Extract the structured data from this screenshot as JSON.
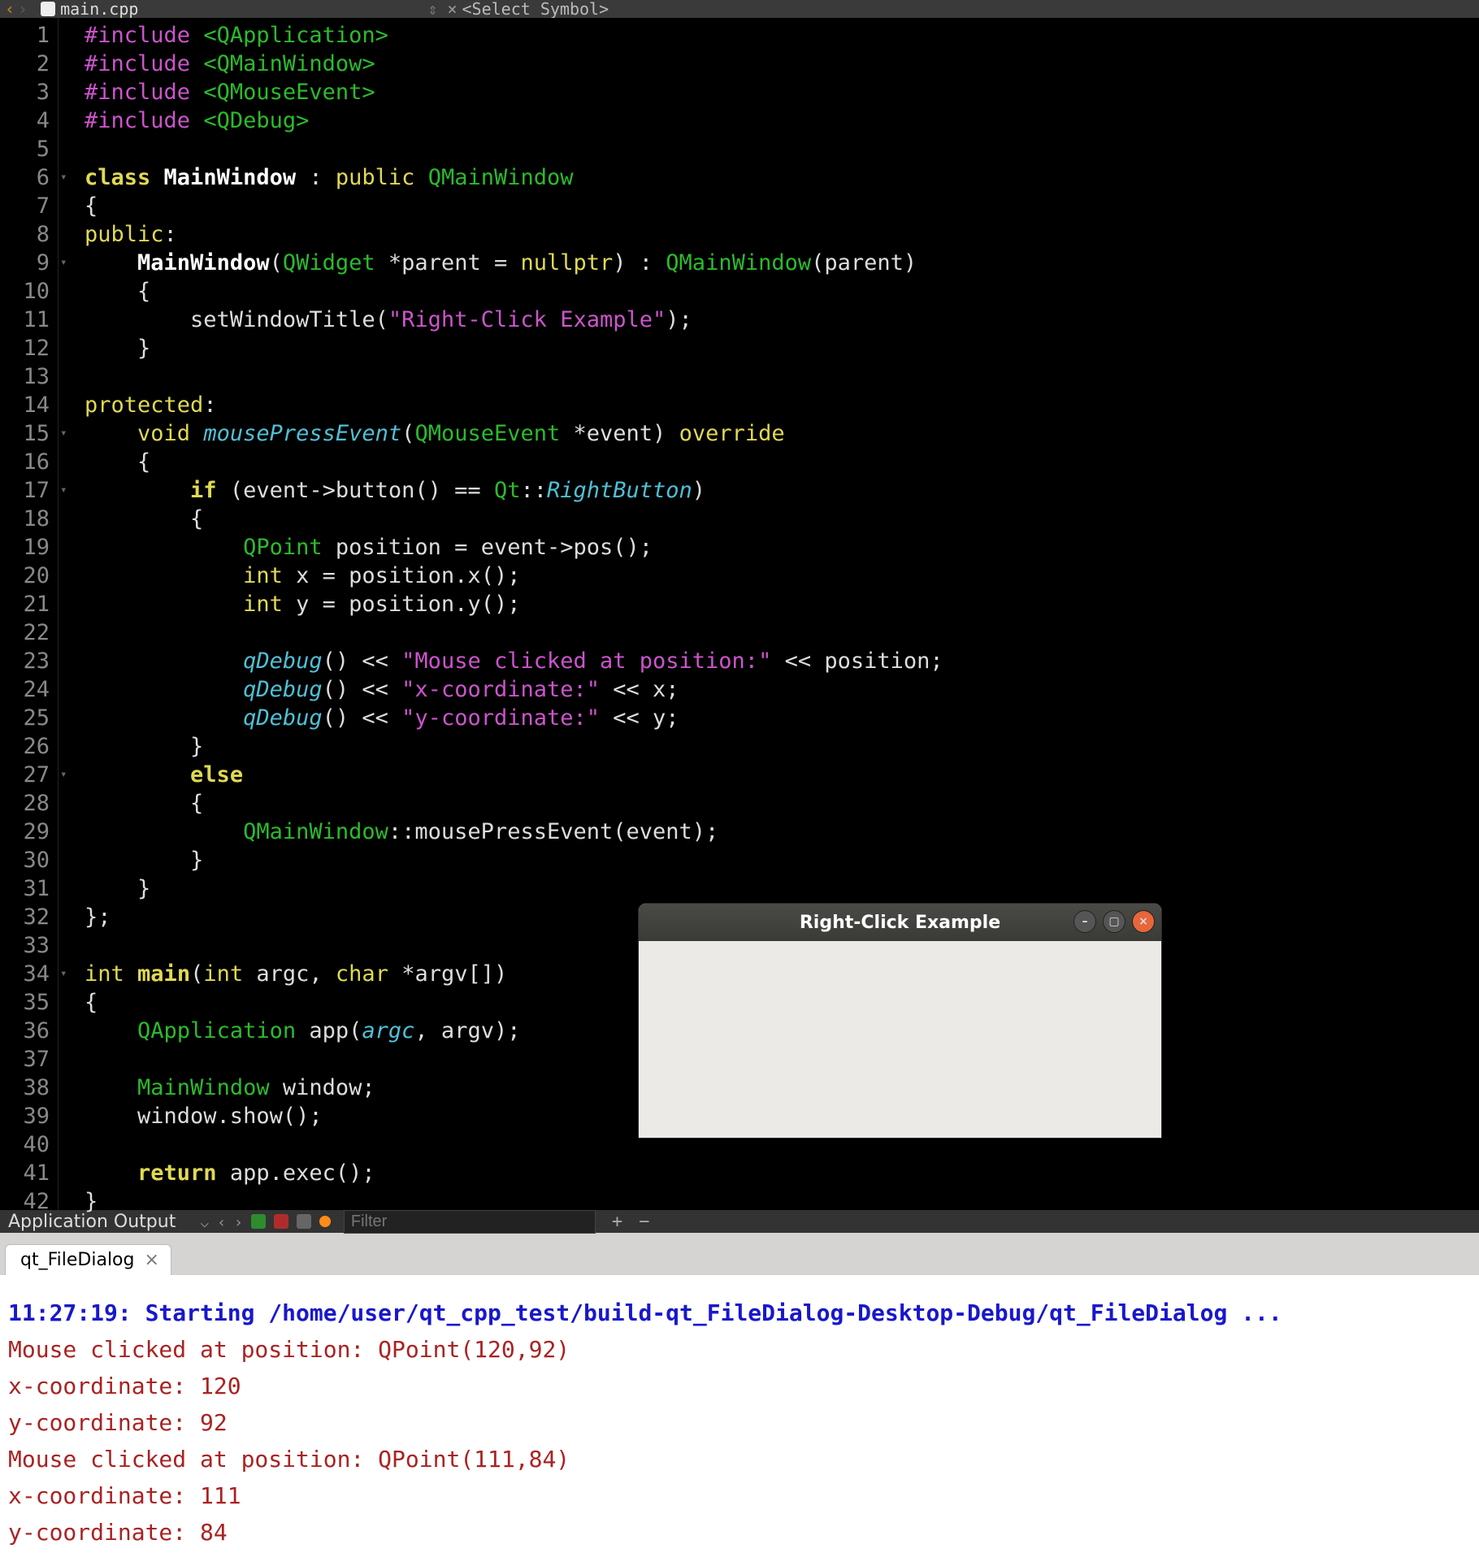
{
  "tabstrip": {
    "filename": "main.cpp",
    "symbol_selector": "<Select Symbol>"
  },
  "editor": {
    "line_count": 42,
    "fold_lines": [
      6,
      9,
      15,
      17,
      27,
      34
    ],
    "code_lines": [
      [
        {
          "c": "kw-inc",
          "t": "#include"
        },
        {
          "c": "op",
          "t": " "
        },
        {
          "c": "hdr",
          "t": "<QApplication>"
        }
      ],
      [
        {
          "c": "kw-inc",
          "t": "#include"
        },
        {
          "c": "op",
          "t": " "
        },
        {
          "c": "hdr",
          "t": "<QMainWindow>"
        }
      ],
      [
        {
          "c": "kw-inc",
          "t": "#include"
        },
        {
          "c": "op",
          "t": " "
        },
        {
          "c": "hdr",
          "t": "<QMouseEvent>"
        }
      ],
      [
        {
          "c": "kw-inc",
          "t": "#include"
        },
        {
          "c": "op",
          "t": " "
        },
        {
          "c": "hdr",
          "t": "<QDebug>"
        }
      ],
      [],
      [
        {
          "c": "kw-yel",
          "t": "class"
        },
        {
          "c": "op",
          "t": " "
        },
        {
          "c": "boldw",
          "t": "MainWindow"
        },
        {
          "c": "op",
          "t": " : "
        },
        {
          "c": "kw-yel2",
          "t": "public"
        },
        {
          "c": "op",
          "t": " "
        },
        {
          "c": "type",
          "t": "QMainWindow"
        }
      ],
      [
        {
          "c": "op",
          "t": "{"
        }
      ],
      [
        {
          "c": "kw-yel2",
          "t": "public"
        },
        {
          "c": "op",
          "t": ":"
        }
      ],
      [
        {
          "c": "op",
          "t": "    "
        },
        {
          "c": "boldw",
          "t": "MainWindow"
        },
        {
          "c": "op",
          "t": "("
        },
        {
          "c": "type",
          "t": "QWidget"
        },
        {
          "c": "op",
          "t": " *parent = "
        },
        {
          "c": "kw-yel2",
          "t": "nullptr"
        },
        {
          "c": "op",
          "t": ") : "
        },
        {
          "c": "type",
          "t": "QMainWindow"
        },
        {
          "c": "op",
          "t": "(parent)"
        }
      ],
      [
        {
          "c": "op",
          "t": "    {"
        }
      ],
      [
        {
          "c": "op",
          "t": "        setWindowTitle("
        },
        {
          "c": "str",
          "t": "\"Right-Click Example\""
        },
        {
          "c": "op",
          "t": ");"
        }
      ],
      [
        {
          "c": "op",
          "t": "    }"
        }
      ],
      [],
      [
        {
          "c": "kw-yel2",
          "t": "protected"
        },
        {
          "c": "op",
          "t": ":"
        }
      ],
      [
        {
          "c": "op",
          "t": "    "
        },
        {
          "c": "kw-yel2",
          "t": "void"
        },
        {
          "c": "op",
          "t": " "
        },
        {
          "c": "func",
          "t": "mousePressEvent"
        },
        {
          "c": "op",
          "t": "("
        },
        {
          "c": "type",
          "t": "QMouseEvent"
        },
        {
          "c": "op",
          "t": " *event) "
        },
        {
          "c": "kw-yel2",
          "t": "override"
        }
      ],
      [
        {
          "c": "op",
          "t": "    {"
        }
      ],
      [
        {
          "c": "op",
          "t": "        "
        },
        {
          "c": "kw-yel",
          "t": "if"
        },
        {
          "c": "op",
          "t": " (event->button() == "
        },
        {
          "c": "type",
          "t": "Qt"
        },
        {
          "c": "op",
          "t": "::"
        },
        {
          "c": "enum",
          "t": "RightButton"
        },
        {
          "c": "op",
          "t": ")"
        }
      ],
      [
        {
          "c": "op",
          "t": "        {"
        }
      ],
      [
        {
          "c": "op",
          "t": "            "
        },
        {
          "c": "type",
          "t": "QPoint"
        },
        {
          "c": "op",
          "t": " position = event->pos();"
        }
      ],
      [
        {
          "c": "op",
          "t": "            "
        },
        {
          "c": "kw-yel2",
          "t": "int"
        },
        {
          "c": "op",
          "t": " x = position.x();"
        }
      ],
      [
        {
          "c": "op",
          "t": "            "
        },
        {
          "c": "kw-yel2",
          "t": "int"
        },
        {
          "c": "op",
          "t": " y = position.y();"
        }
      ],
      [],
      [
        {
          "c": "op",
          "t": "            "
        },
        {
          "c": "func",
          "t": "qDebug"
        },
        {
          "c": "op",
          "t": "() << "
        },
        {
          "c": "str",
          "t": "\"Mouse clicked at position:\""
        },
        {
          "c": "op",
          "t": " << position;"
        }
      ],
      [
        {
          "c": "op",
          "t": "            "
        },
        {
          "c": "func",
          "t": "qDebug"
        },
        {
          "c": "op",
          "t": "() << "
        },
        {
          "c": "str",
          "t": "\"x-coordinate:\""
        },
        {
          "c": "op",
          "t": " << x;"
        }
      ],
      [
        {
          "c": "op",
          "t": "            "
        },
        {
          "c": "func",
          "t": "qDebug"
        },
        {
          "c": "op",
          "t": "() << "
        },
        {
          "c": "str",
          "t": "\"y-coordinate:\""
        },
        {
          "c": "op",
          "t": " << y;"
        }
      ],
      [
        {
          "c": "op",
          "t": "        }"
        }
      ],
      [
        {
          "c": "op",
          "t": "        "
        },
        {
          "c": "kw-yel",
          "t": "else"
        }
      ],
      [
        {
          "c": "op",
          "t": "        {"
        }
      ],
      [
        {
          "c": "op",
          "t": "            "
        },
        {
          "c": "type",
          "t": "QMainWindow"
        },
        {
          "c": "op",
          "t": "::mousePressEvent(event);"
        }
      ],
      [
        {
          "c": "op",
          "t": "        }"
        }
      ],
      [
        {
          "c": "op",
          "t": "    }"
        }
      ],
      [
        {
          "c": "op",
          "t": "};"
        }
      ],
      [],
      [
        {
          "c": "kw-yel2",
          "t": "int"
        },
        {
          "c": "op",
          "t": " "
        },
        {
          "c": "funcname",
          "t": "main"
        },
        {
          "c": "op",
          "t": "("
        },
        {
          "c": "kw-yel2",
          "t": "int"
        },
        {
          "c": "op",
          "t": " argc, "
        },
        {
          "c": "kw-yel2",
          "t": "char"
        },
        {
          "c": "op",
          "t": " *argv[])"
        }
      ],
      [
        {
          "c": "op",
          "t": "{"
        }
      ],
      [
        {
          "c": "op",
          "t": "    "
        },
        {
          "c": "type",
          "t": "QApplication"
        },
        {
          "c": "op",
          "t": " app("
        },
        {
          "c": "par",
          "t": "argc"
        },
        {
          "c": "op",
          "t": ", argv);"
        }
      ],
      [],
      [
        {
          "c": "op",
          "t": "    "
        },
        {
          "c": "type",
          "t": "MainWindow"
        },
        {
          "c": "op",
          "t": " window;"
        }
      ],
      [
        {
          "c": "op",
          "t": "    window.show();"
        }
      ],
      [],
      [
        {
          "c": "op",
          "t": "    "
        },
        {
          "c": "kw-yel",
          "t": "return"
        },
        {
          "c": "op",
          "t": " app.exec();"
        }
      ],
      [
        {
          "c": "op",
          "t": "}"
        }
      ]
    ]
  },
  "app_window": {
    "title": "Right-Click Example"
  },
  "panel": {
    "title": "Application Output",
    "filter_placeholder": "Filter",
    "plus": "+",
    "minus": "−"
  },
  "output_tab": {
    "label": "qt_FileDialog",
    "close": "×"
  },
  "console": {
    "start": "11:27:19: Starting /home/user/qt_cpp_test/build-qt_FileDialog-Desktop-Debug/qt_FileDialog ...",
    "lines": [
      "Mouse clicked at position: QPoint(120,92)",
      "x-coordinate: 120",
      "y-coordinate: 92",
      "Mouse clicked at position: QPoint(111,84)",
      "x-coordinate: 111",
      "y-coordinate: 84"
    ]
  }
}
